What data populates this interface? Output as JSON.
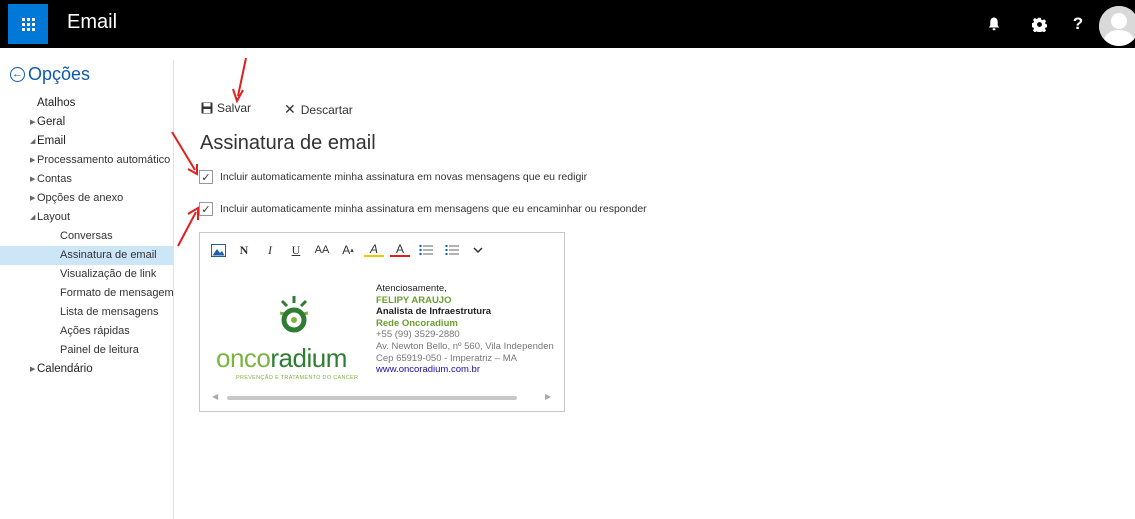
{
  "app": {
    "title": "Email"
  },
  "topbar": {
    "icons": [
      "waffle-icon",
      "bell-icon",
      "gear-icon",
      "help-icon",
      "avatar"
    ],
    "help_label": "?"
  },
  "nav": {
    "back_label": "Opções",
    "items": [
      {
        "label": "Atalhos",
        "level": 0,
        "expand": ""
      },
      {
        "label": "Geral",
        "level": 0,
        "expand": "collapsed"
      },
      {
        "label": "Email",
        "level": 0,
        "expand": "expanded"
      },
      {
        "label": "Processamento automático",
        "level": 1,
        "expand": "collapsed"
      },
      {
        "label": "Contas",
        "level": 1,
        "expand": "collapsed"
      },
      {
        "label": "Opções de anexo",
        "level": 1,
        "expand": "collapsed"
      },
      {
        "label": "Layout",
        "level": 1,
        "expand": "expanded"
      },
      {
        "label": "Conversas",
        "level": 2,
        "expand": ""
      },
      {
        "label": "Assinatura de email",
        "level": 2,
        "expand": "",
        "selected": true
      },
      {
        "label": "Visualização de link",
        "level": 2,
        "expand": ""
      },
      {
        "label": "Formato de mensagem",
        "level": 2,
        "expand": ""
      },
      {
        "label": "Lista de mensagens",
        "level": 2,
        "expand": ""
      },
      {
        "label": "Ações rápidas",
        "level": 2,
        "expand": ""
      },
      {
        "label": "Painel de leitura",
        "level": 2,
        "expand": ""
      },
      {
        "label": "Calendário",
        "level": 0,
        "expand": "collapsed"
      }
    ]
  },
  "commands": {
    "save_label": "Salvar",
    "discard_label": "Descartar"
  },
  "page": {
    "title": "Assinatura de email",
    "option1": "Incluir automaticamente minha assinatura em novas mensagens que eu redigir",
    "option1_checked": true,
    "option2": "Incluir automaticamente minha assinatura em mensagens que eu encaminhar ou responder",
    "option2_checked": true
  },
  "editor": {
    "toolbar": [
      "image-icon",
      "bold-icon",
      "italic-icon",
      "underline-icon",
      "font-size-icon",
      "grow-font-icon",
      "highlight-icon",
      "font-color-icon",
      "bullets-icon",
      "numbering-icon",
      "more-chevron-icon"
    ],
    "toolbar_glyphs": {
      "bold": "N",
      "italic": "I",
      "underline": "U",
      "font_size": "AA",
      "grow": "A",
      "highlight": "A",
      "font_color": "A"
    },
    "logo": {
      "name_light": "onco",
      "name_dark": "radium",
      "tagline": "PREVENÇÃO E TRATAMENTO DO CANCER"
    },
    "signature": {
      "greeting": "Atenciosamente,",
      "name": "FELIPY ARAUJO",
      "role": "Analista de Infraestrutura",
      "company": "Rede Oncoradium",
      "phone": "+55 (99) 3529-2880",
      "address": "Av. Newton Bello, nº 560, Vila Independen",
      "cep": "Cep 65919-050 - Imperatriz – MA",
      "website": "www.oncoradium.com.br"
    }
  },
  "colors": {
    "topbar": "#000000",
    "accent": "#0078d7",
    "selected_nav": "#cde6f7",
    "brand_green": "#7cb342",
    "arrow": "#e02020"
  }
}
